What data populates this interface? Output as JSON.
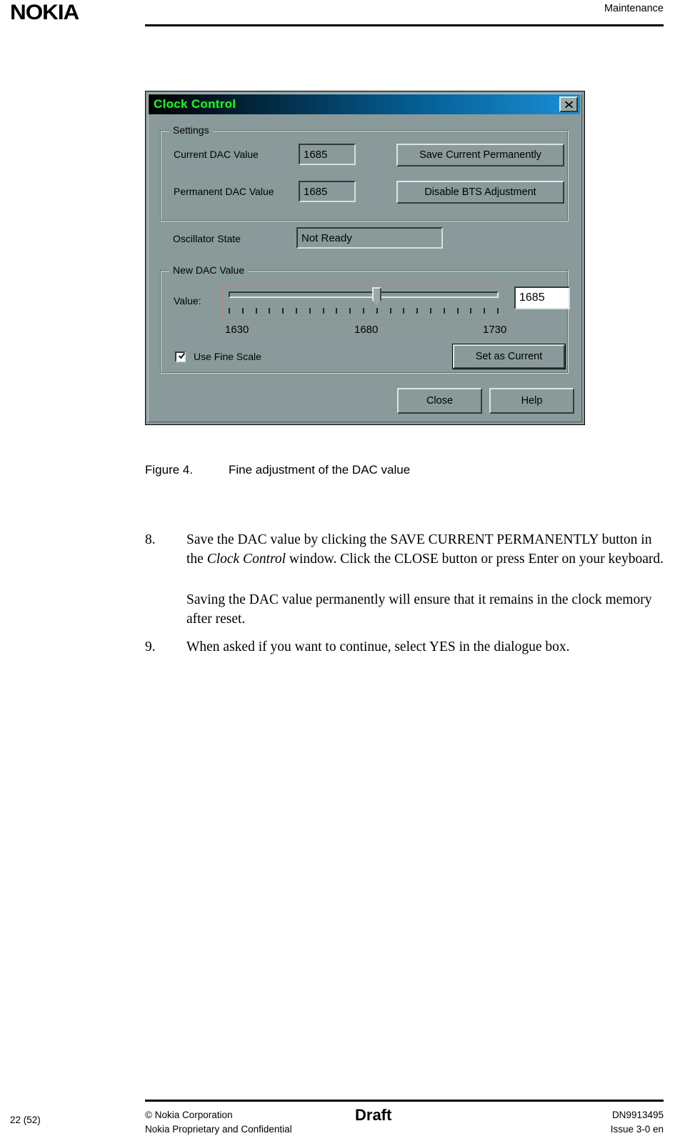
{
  "header": {
    "logo": "NOKIA",
    "title": "Maintenance"
  },
  "dialog": {
    "title": "Clock Control",
    "close_icon": "close-icon",
    "settings_group": {
      "legend": "Settings",
      "current_dac_label": "Current DAC Value",
      "current_dac_value": "1685",
      "permanent_dac_label": "Permanent DAC Value",
      "permanent_dac_value": "1685",
      "oscillator_label": "Oscillator State",
      "oscillator_value": "Not Ready",
      "save_current_button": "Save Current Permanently",
      "disable_bts_button": "Disable BTS Adjustment"
    },
    "new_dac_group": {
      "legend": "New DAC Value",
      "value_label": "Value:",
      "value_field": "1685",
      "scale_min_label": "1630",
      "scale_mid_label": "1680",
      "scale_max_label": "1730",
      "tick_count": 21,
      "slider_min": 1630,
      "slider_max": 1730,
      "slider_value": 1685,
      "fine_scale_label": "Use Fine Scale",
      "fine_scale_checked": true,
      "set_as_current_button": "Set as Current"
    },
    "close_button": "Close",
    "help_button": "Help"
  },
  "figure": {
    "number": "Figure 4.",
    "caption": "Fine adjustment of the DAC value"
  },
  "steps": [
    {
      "number": "8.",
      "text_part1": "Save the DAC value by clicking the SAVE CURRENT PERMANENTLY button in the ",
      "italic": "Clock Control",
      "text_part2": " window. Click the CLOSE button or press Enter on your keyboard."
    },
    {
      "number": "9.",
      "text_part1": "When asked if you want to continue, select YES in the dialogue box.",
      "italic": "",
      "text_part2": ""
    }
  ],
  "note_paragraph": "Saving the DAC value permanently will ensure that it remains in the clock memory after reset.",
  "footer": {
    "page": "22 (52)",
    "copyright": "© Nokia Corporation",
    "confidential": "Nokia Proprietary and Confidential",
    "draft": "Draft",
    "doc_number": "DN9913495",
    "issue": "Issue 3-0 en"
  }
}
